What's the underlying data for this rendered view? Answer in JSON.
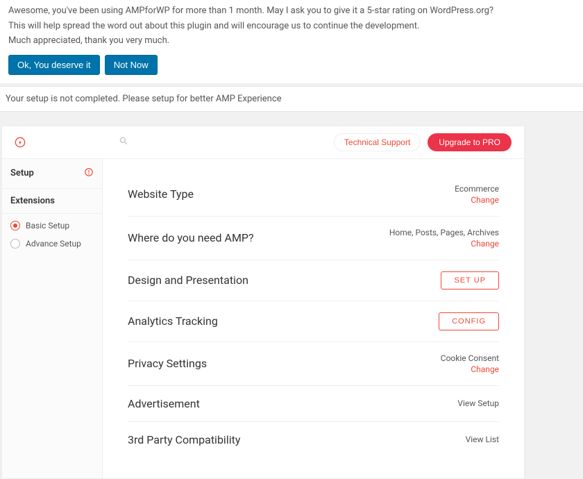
{
  "notice": {
    "line1": "Awesome, you've been using AMPforWP for more than 1 month. May I ask you to give it a 5-star rating on WordPress.org?",
    "line2": "This will help spread the word out about this plugin and will encourage us to continue the development.",
    "line3": "Much appreciated, thank you very much.",
    "ok_btn": "Ok, You deserve it",
    "not_now_btn": "Not Now"
  },
  "setup_warning": "Your setup is not completed. Please setup for better AMP Experience",
  "topbar": {
    "tech_support": "Technical Support",
    "upgrade": "Upgrade to PRO"
  },
  "sidebar": {
    "setup": "Setup",
    "extensions": "Extensions",
    "basic": "Basic Setup",
    "advance": "Advance Setup"
  },
  "rows": {
    "website_type": {
      "title": "Website Type",
      "value": "Ecommerce",
      "change": "Change"
    },
    "where_amp": {
      "title": "Where do you need AMP?",
      "value": "Home, Posts, Pages, Archives",
      "change": "Change"
    },
    "design": {
      "title": "Design and Presentation",
      "btn": "SET UP"
    },
    "analytics": {
      "title": "Analytics Tracking",
      "btn": "CONFIG"
    },
    "privacy": {
      "title": "Privacy Settings",
      "value": "Cookie Consent",
      "change": "Change"
    },
    "ads": {
      "title": "Advertisement",
      "link": "View Setup"
    },
    "compat": {
      "title": "3rd Party Compatibility",
      "link": "View List"
    }
  }
}
